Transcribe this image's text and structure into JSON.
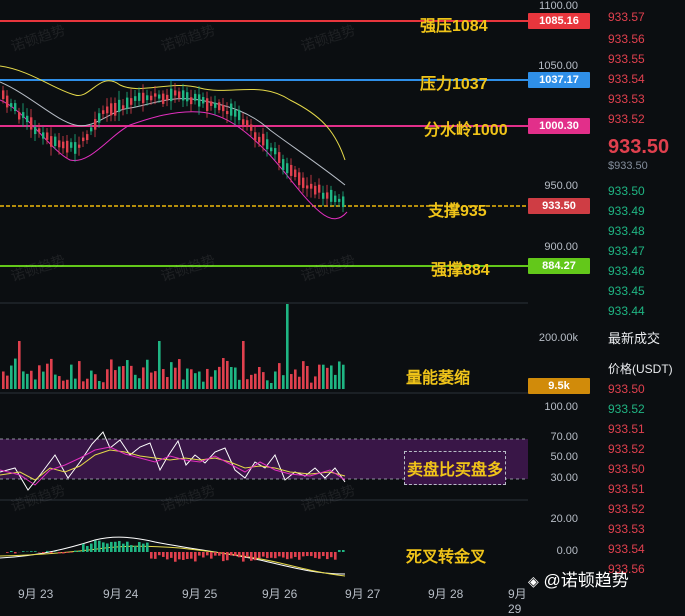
{
  "annotations": {
    "strong_resistance": "强压1084",
    "resistance": "压力1037",
    "watershed": "分水岭1000",
    "support": "支撑935",
    "strong_support": "强撑884",
    "volume_note": "量能萎缩",
    "rsi_note": "卖盘比买盘多",
    "macd_note": "死叉转金叉"
  },
  "price_axis": [
    "1100.00",
    "1050.00",
    "950.00",
    "900.00"
  ],
  "price_tags": {
    "strong_resistance": "1085.16",
    "resistance": "1037.17",
    "watershed": "1000.30",
    "current": "933.50",
    "strong_support": "884.27"
  },
  "volume_axis": [
    "200.00k"
  ],
  "volume_tag": "9.5k",
  "rsi_axis": [
    "100.00",
    "70.00",
    "50.00",
    "30.00"
  ],
  "macd_axis": [
    "20.00",
    "0.00"
  ],
  "dates": [
    "9月 23",
    "9月 24",
    "9月 25",
    "9月 26",
    "9月 27",
    "9月 28",
    "9月 29"
  ],
  "colors": {
    "strong_resistance": "#e8363d",
    "resistance": "#2f8fe8",
    "watershed": "#e22f8a",
    "support": "#f0b90b",
    "strong_support": "#63c81a",
    "up": "#1fb583",
    "down": "#e0404e"
  },
  "order_book": {
    "asks_top": [
      "933.57",
      "933.56",
      "933.55",
      "933.54",
      "933.53",
      "933.52"
    ],
    "last_price": "933.50",
    "last_price_sub": "$933.50",
    "bids": [
      "933.50",
      "933.49",
      "933.48",
      "933.47",
      "933.46",
      "933.45",
      "933.44"
    ],
    "trades_title": "最新成交",
    "trades_header": "价格(USDT)",
    "trades": [
      {
        "price": "933.50",
        "side": "ask"
      },
      {
        "price": "933.52",
        "side": "bid"
      },
      {
        "price": "933.51",
        "side": "ask"
      },
      {
        "price": "933.52",
        "side": "ask"
      },
      {
        "price": "933.50",
        "side": "ask"
      },
      {
        "price": "933.51",
        "side": "ask"
      },
      {
        "price": "933.52",
        "side": "ask"
      },
      {
        "price": "933.53",
        "side": "ask"
      },
      {
        "price": "933.54",
        "side": "ask"
      },
      {
        "price": "933.56",
        "side": "ask"
      }
    ]
  },
  "brand": "@诺顿趋势",
  "watermark": "诺顿趋势"
}
